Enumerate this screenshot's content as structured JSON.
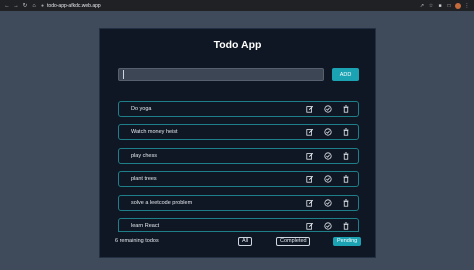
{
  "browser": {
    "url": "todo-app-afkdc.web.app"
  },
  "app": {
    "title": "Todo App",
    "input_value": "",
    "add_label": "ADD",
    "todos": [
      {
        "label": "Do yoga"
      },
      {
        "label": "Watch money heist"
      },
      {
        "label": "play chess"
      },
      {
        "label": "plant trees"
      },
      {
        "label": "solve a leetcode problem"
      },
      {
        "label": "learn React"
      }
    ],
    "remaining_text": "6 remaining todos",
    "filters": {
      "all": "All",
      "completed": "Completed",
      "pending": "Pending"
    },
    "selected_filter": "Pending",
    "colors": {
      "accent": "#1ba3b4",
      "panel": "#0f1724",
      "page": "#3f4a5a",
      "border": "#1f7f89"
    }
  }
}
